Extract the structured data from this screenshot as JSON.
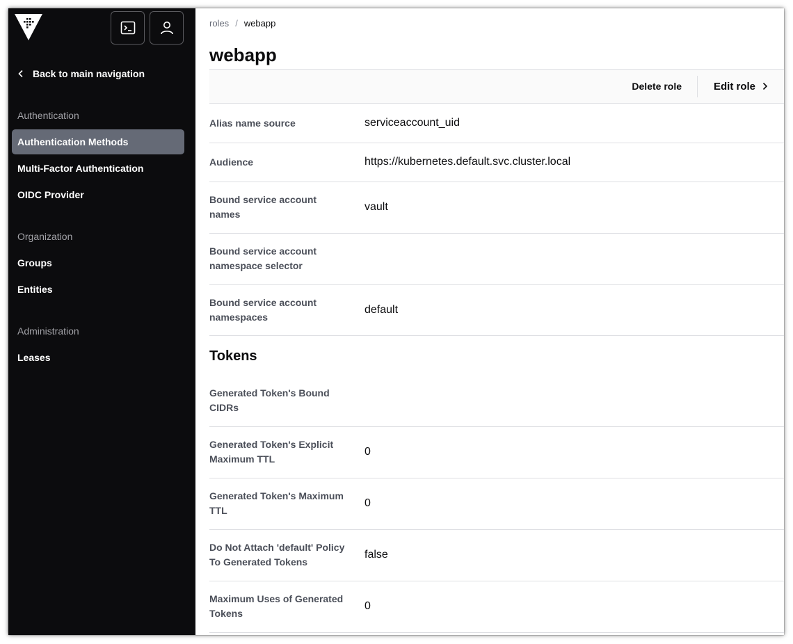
{
  "sidebar": {
    "back_label": "Back to main navigation",
    "sections": [
      {
        "label": "Authentication",
        "items": [
          "Authentication Methods",
          "Multi-Factor Authentication",
          "OIDC Provider"
        ]
      },
      {
        "label": "Organization",
        "items": [
          "Groups",
          "Entities"
        ]
      },
      {
        "label": "Administration",
        "items": [
          "Leases"
        ]
      }
    ],
    "active_item": "Authentication Methods"
  },
  "breadcrumb": {
    "parent": "roles",
    "separator": "/",
    "current": "webapp"
  },
  "page": {
    "title": "webapp"
  },
  "toolbar": {
    "delete_label": "Delete role",
    "edit_label": "Edit role"
  },
  "rows": [
    {
      "label": "Alias name source",
      "value": "serviceaccount_uid"
    },
    {
      "label": "Audience",
      "value": "https://kubernetes.default.svc.cluster.local"
    },
    {
      "label": "Bound service account names",
      "value": "vault"
    },
    {
      "label": "Bound service account namespace selector",
      "value": ""
    },
    {
      "label": "Bound service account namespaces",
      "value": "default"
    }
  ],
  "tokens": {
    "title": "Tokens",
    "rows": [
      {
        "label": "Generated Token's Bound CIDRs",
        "value": ""
      },
      {
        "label": "Generated Token's Explicit Maximum TTL",
        "value": "0"
      },
      {
        "label": "Generated Token's Maximum TTL",
        "value": "0"
      },
      {
        "label": "Do Not Attach 'default' Policy To Generated Tokens",
        "value": "false"
      },
      {
        "label": "Maximum Uses of Generated Tokens",
        "value": "0"
      }
    ]
  },
  "colors": {
    "sidebar_bg": "#0c0c0e",
    "active_item_bg": "#656a76",
    "border": "#dedfe3"
  },
  "icons": {
    "logo": "vault-logo-icon",
    "console": "terminal-icon",
    "user": "user-icon",
    "back": "chevron-left-icon",
    "edit": "chevron-right-icon"
  }
}
